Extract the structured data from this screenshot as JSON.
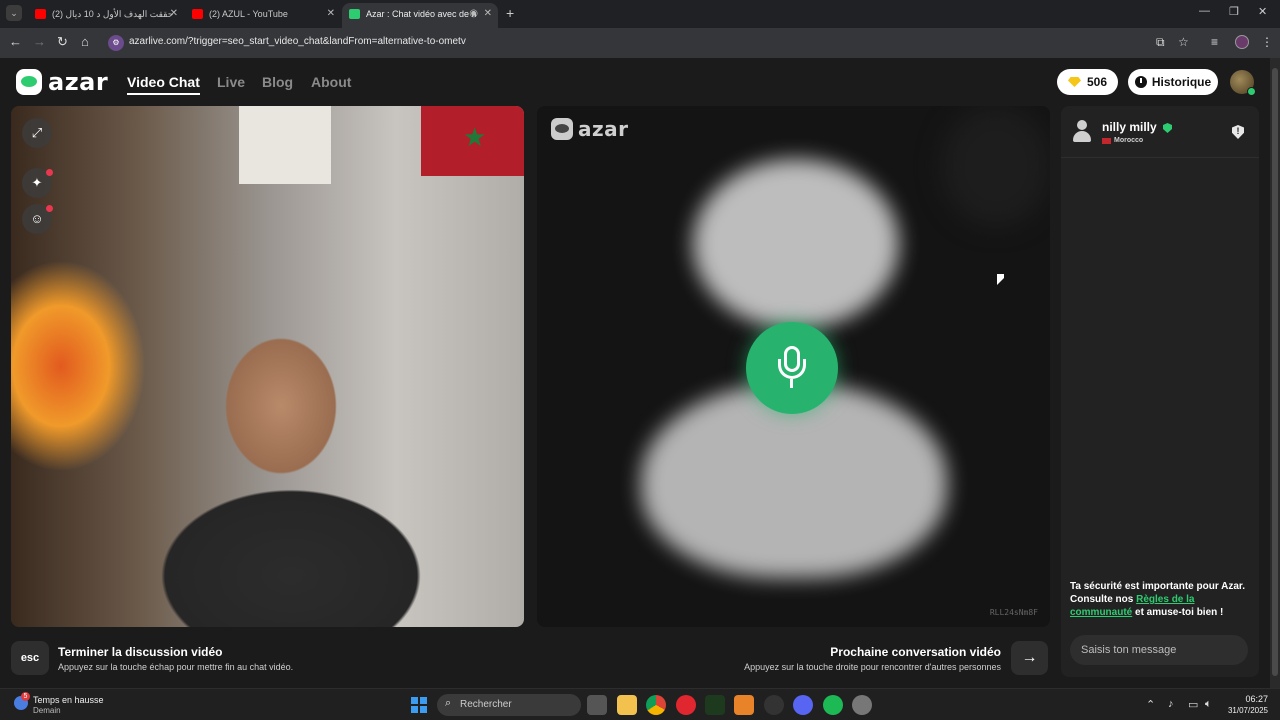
{
  "browser": {
    "tabs": [
      {
        "title": "(2) حققت الهدف الأول د 10 ديال",
        "favicon_color": "#ff0000",
        "active": false
      },
      {
        "title": "(2) AZUL - YouTube",
        "favicon_color": "#ff0000",
        "active": false
      },
      {
        "title": "Azar : Chat vidéo avec de n",
        "favicon_color": "#2ecc71",
        "active": true
      }
    ],
    "new_tab": "+",
    "url": "azarlive.com/?trigger=seo_start_video_chat&landFrom=alternative-to-ometv"
  },
  "app": {
    "logo_text": "azar",
    "nav": [
      {
        "label": "Video Chat",
        "active": true
      },
      {
        "label": "Live",
        "active": false
      },
      {
        "label": "Blog",
        "active": false
      },
      {
        "label": "About",
        "active": false
      }
    ],
    "gems": "506",
    "history_label": "Historique",
    "partner_video": {
      "logo_text": "azar",
      "video_id": "RLL24sNm8F"
    },
    "controls": {
      "esc_key": "esc",
      "end_title": "Terminer la discussion vidéo",
      "end_subtitle": "Appuyez sur la touche échap pour mettre fin au chat vidéo.",
      "next_title": "Prochaine conversation vidéo",
      "next_subtitle": "Appuyez sur la touche droite pour rencontrer d'autres personnes",
      "next_arrow": "→"
    },
    "chat": {
      "partner_name": "nilly milly",
      "partner_country": "Morocco",
      "safety_text_1": "Ta sécurité est importante pour Azar. Consulte nos ",
      "safety_link": "Règles de la communauté",
      "safety_text_2": " et amuse-toi bien !",
      "input_placeholder": "Saisis ton message"
    },
    "colors": {
      "accent": "#2ecc71",
      "mic_button": "#27b36e",
      "background": "#1b1b1b"
    }
  },
  "taskbar": {
    "weather_title": "Temps en hausse",
    "weather_subtitle": "Demain",
    "weather_badge": "5",
    "search_placeholder": "Rechercher",
    "time": "06:27",
    "date": "31/07/2025"
  }
}
